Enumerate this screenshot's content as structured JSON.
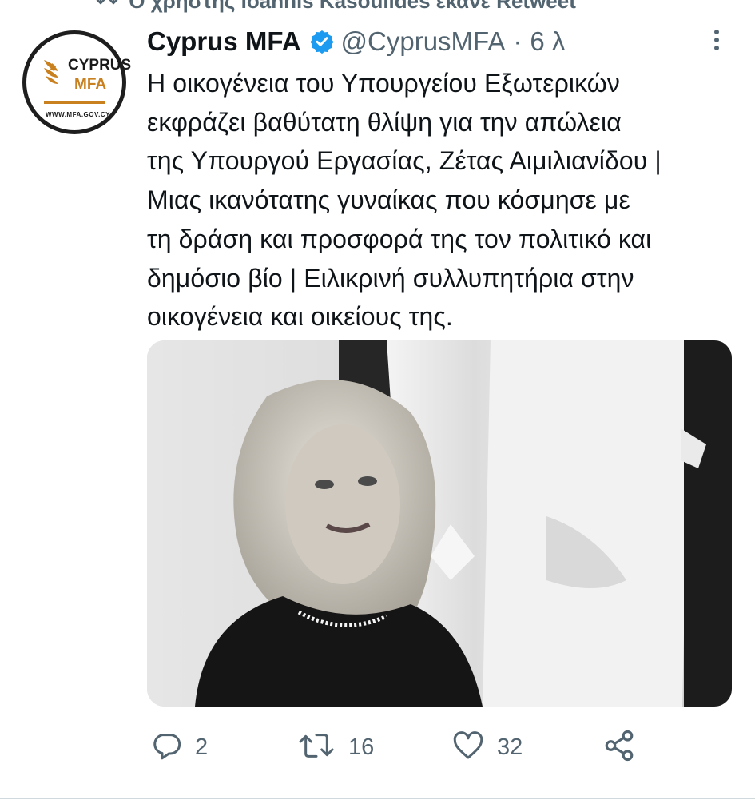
{
  "retweet_context": {
    "text": "Ο χρήστης Ioannis Kasoulides έκανε Retweet",
    "icon": "retweet-icon"
  },
  "avatar": {
    "logo_line1": "CYPRUS",
    "logo_line2": "MFA",
    "logo_url": "WWW.MFA.GOV.CY",
    "brand_color": "#c9801f"
  },
  "tweet": {
    "display_name": "Cyprus MFA",
    "handle": "@CyprusMFA",
    "separator": "·",
    "time": "6 λ",
    "verified_color": "#1d9bf0",
    "text_lines": [
      "Η οικογένεια του Υπουργείου Εξωτερικών",
      "εκφράζει βαθύτατη θλίψη για την απώλεια",
      "της Υπουργού Εργασίας, Ζέτας Αιμιλιανίδου |",
      "Μιας ικανότατης γυναίκας που κόσμησε με",
      "τη δράση και προσφορά της τον πολιτικό και",
      "δημόσιο βίο | Ειλικρινή συλλυπητήρια στην",
      "οικογένεια και οικείους της."
    ],
    "photo_description_icon": "portrait-photo"
  },
  "actions": {
    "reply_count": "2",
    "retweet_count": "16",
    "like_count": "32",
    "icons": [
      "reply-icon",
      "retweet-icon",
      "like-icon",
      "share-icon"
    ]
  },
  "colors": {
    "secondary_text": "#536471",
    "primary_text": "#0f1419",
    "divider": "#cfd9de"
  }
}
